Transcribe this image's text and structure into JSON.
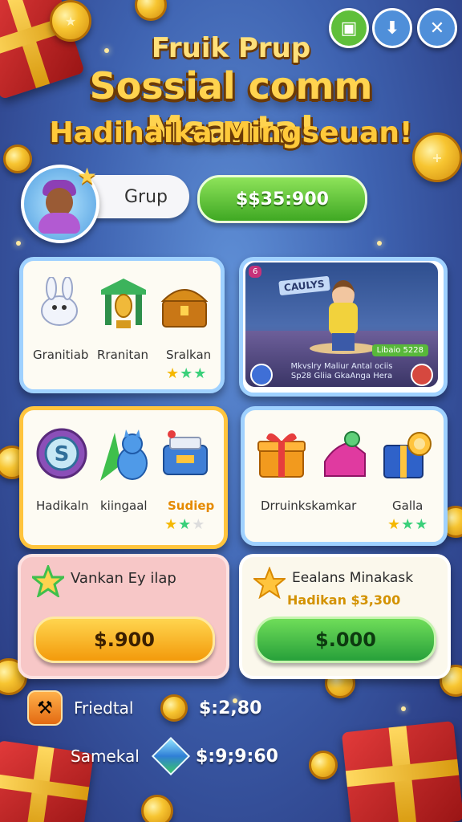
{
  "header": {
    "line1": "Fruik Prup",
    "line2": "Sossial comm Msanta!",
    "line3": "Hadihaika Mingseuan!"
  },
  "top_buttons": [
    {
      "icon": "clipboard-icon",
      "color": "#5fbf3a"
    },
    {
      "icon": "download-icon",
      "color": "#4f8fd9"
    },
    {
      "icon": "close-icon",
      "color": "#4f8fd9"
    }
  ],
  "profile": {
    "group_label": "Grup",
    "balance": "$$35:900"
  },
  "card1": {
    "items": [
      {
        "icon": "bunny-icon",
        "label": "Granitiab"
      },
      {
        "icon": "trophy-icon",
        "label": "Rranitan"
      },
      {
        "icon": "chest-icon",
        "label": "Sralkan"
      }
    ],
    "stars": "★★★"
  },
  "scene_card": {
    "badge": "6",
    "sign": "CAULYS",
    "tag_left": "Libaio",
    "tag_right": "5228",
    "desc_line1": "Mkvslry Maliur Antal ociis",
    "desc_line2": "Sp28 Gliia GkaAnga Hera"
  },
  "card3": {
    "items": [
      {
        "icon": "dollar-medal-icon",
        "label": "Hadikaln"
      },
      {
        "icon": "cat-statue-icon",
        "label": "kiingaal"
      },
      {
        "icon": "toolbox-icon",
        "label": "Sudiep"
      }
    ],
    "stars": "★★★"
  },
  "card4": {
    "items": [
      {
        "icon": "gift-box-icon",
        "label": "Drruinkskamkar"
      },
      {
        "icon": "gem-shoe-icon",
        "label": ""
      },
      {
        "icon": "gift-medal-icon",
        "label": "Galla"
      }
    ],
    "stars": "★★★"
  },
  "offer_left": {
    "title": "Vankan Ey ilap",
    "button": "$.900"
  },
  "offer_right": {
    "title": "Eealans Minakask",
    "subtitle": "Hadikan $3,300",
    "button": "$.000"
  },
  "stats": [
    {
      "icon": "hammer-icon",
      "label": "Friedtal",
      "value": "$:2,80"
    },
    {
      "icon": "cube-icon",
      "label": "Samekal",
      "value": "$:9;9:60"
    }
  ]
}
